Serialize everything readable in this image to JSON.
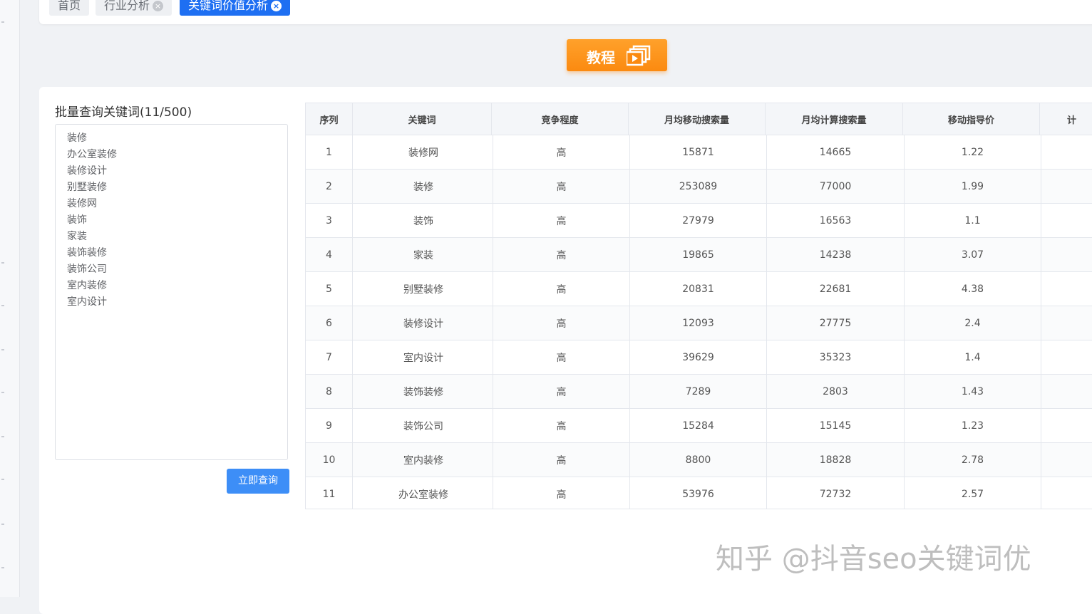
{
  "tabs": [
    {
      "label": "首页",
      "closable": false,
      "active": false
    },
    {
      "label": "行业分析",
      "closable": true,
      "active": false
    },
    {
      "label": "关键词价值分析",
      "closable": true,
      "active": true
    }
  ],
  "tutorial": {
    "label": "教程",
    "icon": "video-play-icon"
  },
  "batch": {
    "title": "批量查询关键词(11/500)",
    "keywords": [
      "装修",
      "办公室装修",
      "装修设计",
      "别墅装修",
      "装修网",
      "装饰",
      "家装",
      "装饰装修",
      "装饰公司",
      "室内装修",
      "室内设计"
    ],
    "submit_label": "立即查询"
  },
  "table": {
    "columns": [
      "序列",
      "关键词",
      "竞争程度",
      "月均移动搜索量",
      "月均计算搜索量",
      "移动指导价",
      "计"
    ],
    "rows": [
      [
        "1",
        "装修网",
        "高",
        "15871",
        "14665",
        "1.22",
        ""
      ],
      [
        "2",
        "装修",
        "高",
        "253089",
        "77000",
        "1.99",
        ""
      ],
      [
        "3",
        "装饰",
        "高",
        "27979",
        "16563",
        "1.1",
        ""
      ],
      [
        "4",
        "家装",
        "高",
        "19865",
        "14238",
        "3.07",
        ""
      ],
      [
        "5",
        "别墅装修",
        "高",
        "20831",
        "22681",
        "4.38",
        ""
      ],
      [
        "6",
        "装修设计",
        "高",
        "12093",
        "27775",
        "2.4",
        ""
      ],
      [
        "7",
        "室内设计",
        "高",
        "39629",
        "35323",
        "1.4",
        ""
      ],
      [
        "8",
        "装饰装修",
        "高",
        "7289",
        "2803",
        "1.43",
        ""
      ],
      [
        "9",
        "装饰公司",
        "高",
        "15284",
        "15145",
        "1.23",
        ""
      ],
      [
        "10",
        "室内装修",
        "高",
        "8800",
        "18828",
        "2.78",
        ""
      ],
      [
        "11",
        "办公室装修",
        "高",
        "53976",
        "72732",
        "2.57",
        ""
      ]
    ]
  },
  "watermark": "知乎 @抖音seo关键词优",
  "colors": {
    "accent": "#1e6ff2",
    "tutorial": "#fb8a10",
    "query_button": "#3d8ef7"
  }
}
